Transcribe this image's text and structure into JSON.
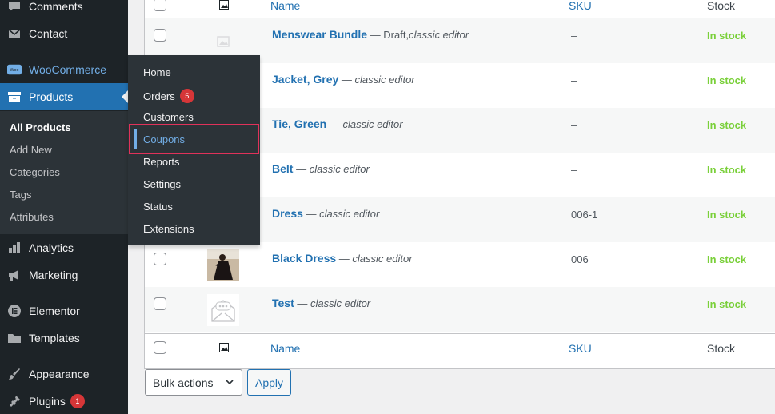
{
  "sidebar": {
    "items": [
      {
        "label": "Comments",
        "icon": "comment-icon"
      },
      {
        "label": "Contact",
        "icon": "envelope-icon"
      },
      {
        "label": "WooCommerce",
        "icon": "woocommerce-icon"
      },
      {
        "label": "Products",
        "icon": "archive-icon"
      },
      {
        "label": "Analytics",
        "icon": "bar-chart-icon"
      },
      {
        "label": "Marketing",
        "icon": "megaphone-icon"
      },
      {
        "label": "Elementor",
        "icon": "elementor-icon"
      },
      {
        "label": "Templates",
        "icon": "folder-icon"
      },
      {
        "label": "Appearance",
        "icon": "paintbrush-icon"
      },
      {
        "label": "Plugins",
        "icon": "plug-icon",
        "badge": "1"
      }
    ],
    "products_submenu": [
      "All Products",
      "Add New",
      "Categories",
      "Tags",
      "Attributes"
    ]
  },
  "woo_flyout": {
    "items": [
      {
        "label": "Home"
      },
      {
        "label": "Orders",
        "badge": "5"
      },
      {
        "label": "Customers"
      },
      {
        "label": "Coupons"
      },
      {
        "label": "Reports"
      },
      {
        "label": "Settings"
      },
      {
        "label": "Status"
      },
      {
        "label": "Extensions"
      }
    ]
  },
  "table": {
    "headers": {
      "name": "Name",
      "sku": "SKU",
      "stock": "Stock"
    },
    "rows": [
      {
        "name": "Menswear Bundle",
        "status": "Draft,",
        "editor": "classic editor",
        "sku": "–",
        "stock": "In stock",
        "thumb": "placeholder"
      },
      {
        "name": "Jacket, Grey",
        "editor": "classic editor",
        "sku": "–",
        "stock": "In stock",
        "thumb": "hidden"
      },
      {
        "name": "Tie, Green",
        "editor": "classic editor",
        "sku": "–",
        "stock": "In stock",
        "thumb": "hidden"
      },
      {
        "name": "Belt",
        "editor": "classic editor",
        "sku": "–",
        "stock": "In stock",
        "thumb": "hidden"
      },
      {
        "name": "Dress",
        "editor": "classic editor",
        "sku": "006-1",
        "stock": "In stock",
        "thumb": "hidden"
      },
      {
        "name": "Black Dress",
        "editor": "classic editor",
        "sku": "006",
        "stock": "In stock",
        "thumb": "photo"
      },
      {
        "name": "Test",
        "editor": "classic editor",
        "sku": "–",
        "stock": "In stock",
        "thumb": "envelope"
      }
    ],
    "separator": "—"
  },
  "bulk": {
    "selected": "Bulk actions",
    "apply_label": "Apply"
  },
  "colors": {
    "sidebar_bg": "#1d2327",
    "active_bg": "#2271b1",
    "link": "#2271b1",
    "in_stock": "#7ad03a",
    "highlight_border": "#e0325a"
  }
}
